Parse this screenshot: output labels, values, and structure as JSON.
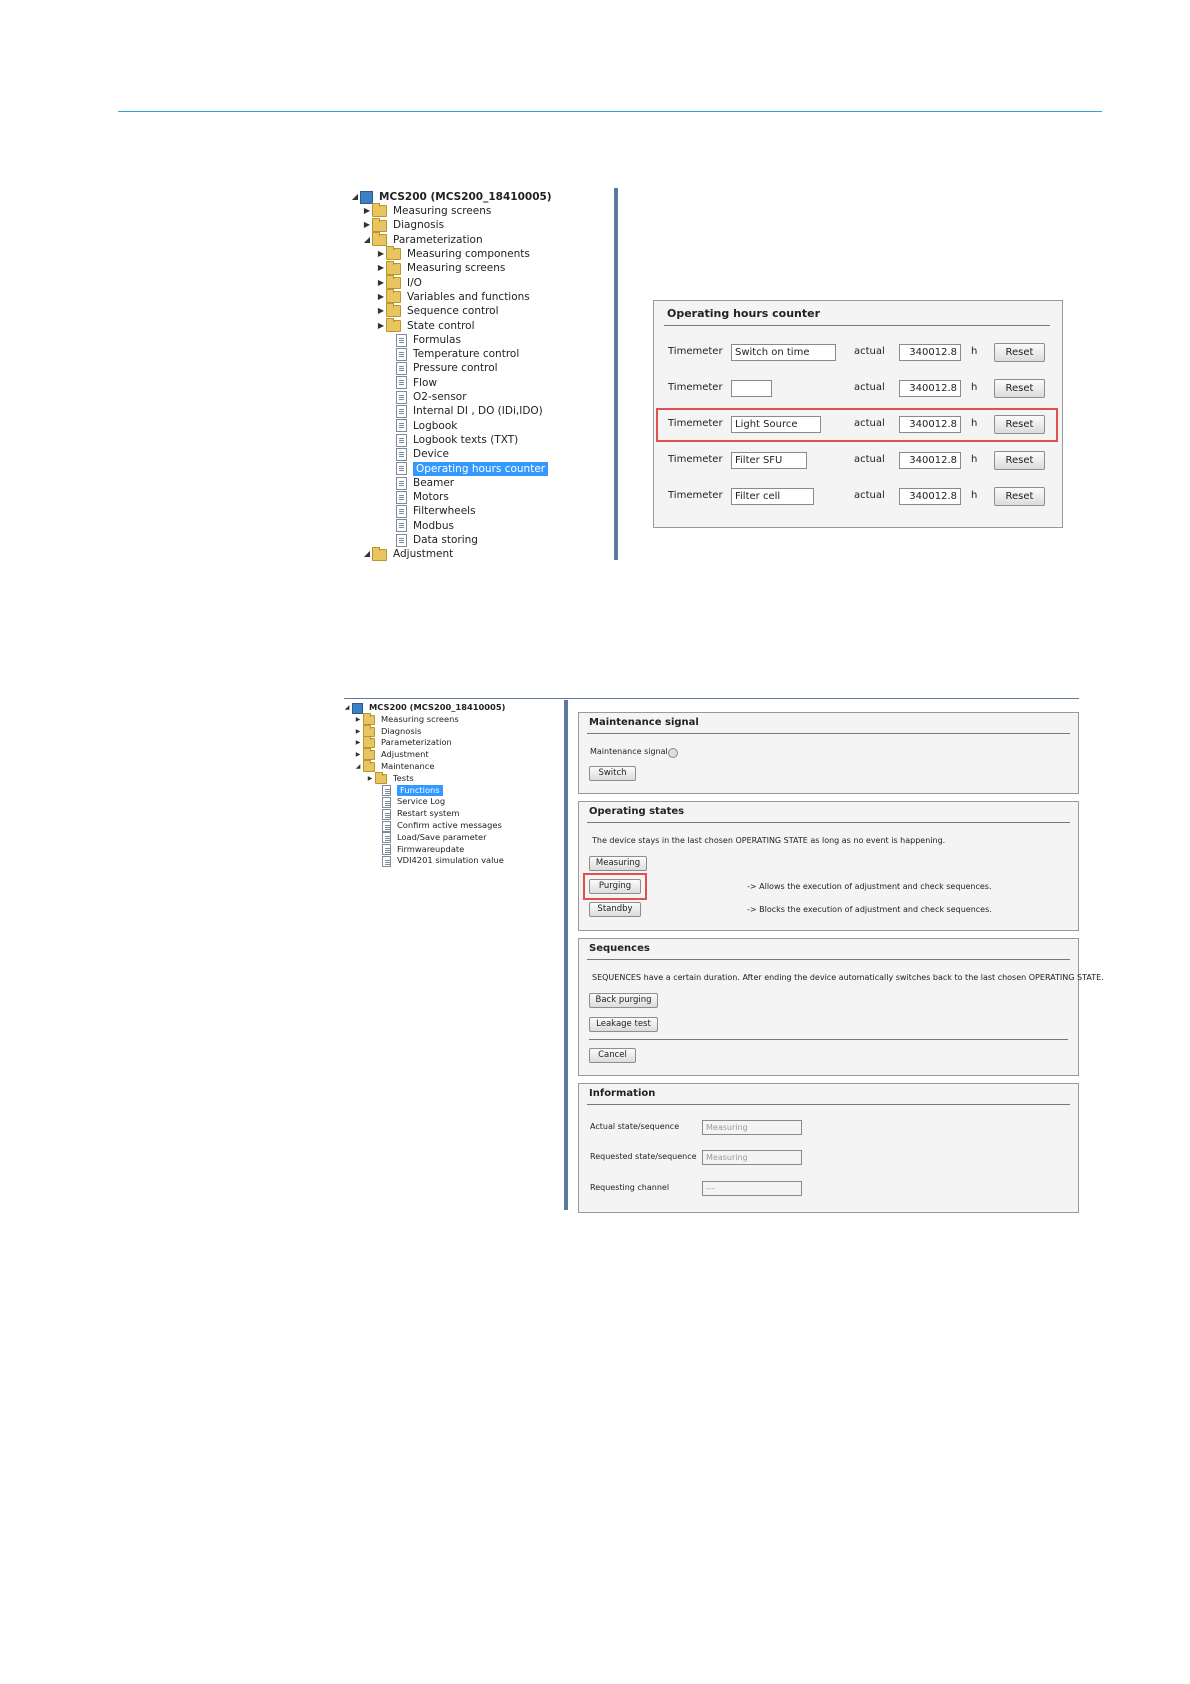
{
  "tree1": {
    "root": "MCS200 (MCS200_18410005)",
    "items": [
      "Measuring screens",
      "Diagnosis",
      "Parameterization",
      "Measuring components",
      "Measuring screens",
      "I/O",
      "Variables and functions",
      "Sequence control",
      "State control",
      "Formulas",
      "Temperature control",
      "Pressure control",
      "Flow",
      "O2-sensor",
      "Internal DI , DO (IDi,IDO)",
      "Logbook",
      "Logbook texts (TXT)",
      "Device",
      "Operating hours counter",
      "Beamer",
      "Motors",
      "Filterwheels",
      "Modbus",
      "Data storing",
      "Adjustment"
    ]
  },
  "ohc": {
    "title": "Operating hours counter",
    "rows": [
      {
        "label": "Timemeter",
        "name": "Switch on time",
        "actual_label": "actual",
        "value": "340012.8",
        "unit": "h",
        "button": "Reset"
      },
      {
        "label": "Timemeter",
        "name": "",
        "actual_label": "actual",
        "value": "340012.8",
        "unit": "h",
        "button": "Reset"
      },
      {
        "label": "Timemeter",
        "name": "Light Source",
        "actual_label": "actual",
        "value": "340012.8",
        "unit": "h",
        "button": "Reset"
      },
      {
        "label": "Timemeter",
        "name": "Filter SFU",
        "actual_label": "actual",
        "value": "340012.8",
        "unit": "h",
        "button": "Reset"
      },
      {
        "label": "Timemeter",
        "name": "Filter cell",
        "actual_label": "actual",
        "value": "340012.8",
        "unit": "h",
        "button": "Reset"
      }
    ]
  },
  "tree2": {
    "root": "MCS200 (MCS200_18410005)",
    "items": [
      "Measuring screens",
      "Diagnosis",
      "Parameterization",
      "Adjustment",
      "Maintenance",
      "Tests",
      "Functions",
      "Service Log",
      "Restart system",
      "Confirm active messages",
      "Load/Save parameter",
      "Firmwareupdate",
      "VDI4201 simulation value"
    ]
  },
  "maint": {
    "title": "Maintenance signal",
    "label": "Maintenance signal",
    "switch": "Switch"
  },
  "states": {
    "title": "Operating states",
    "desc": "The device stays in the last chosen OPERATING STATE as long as no event is happening.",
    "measuring": "Measuring",
    "purging": "Purging",
    "purging_note": "-> Allows the execution of adjustment and check sequences.",
    "standby": "Standby",
    "standby_note": "-> Blocks the execution of adjustment and check sequences."
  },
  "seq": {
    "title": "Sequences",
    "desc": "SEQUENCES have a certain duration. After ending the device automatically switches back to the last chosen OPERATING STATE.",
    "back_purging": "Back purging",
    "leakage": "Leakage test",
    "cancel": "Cancel"
  },
  "info": {
    "title": "Information",
    "actual_label": "Actual state/sequence",
    "actual_value": "Measuring",
    "requested_label": "Requested state/sequence",
    "requested_value": "Measuring",
    "channel_label": "Requesting channel",
    "channel_value": "---"
  }
}
